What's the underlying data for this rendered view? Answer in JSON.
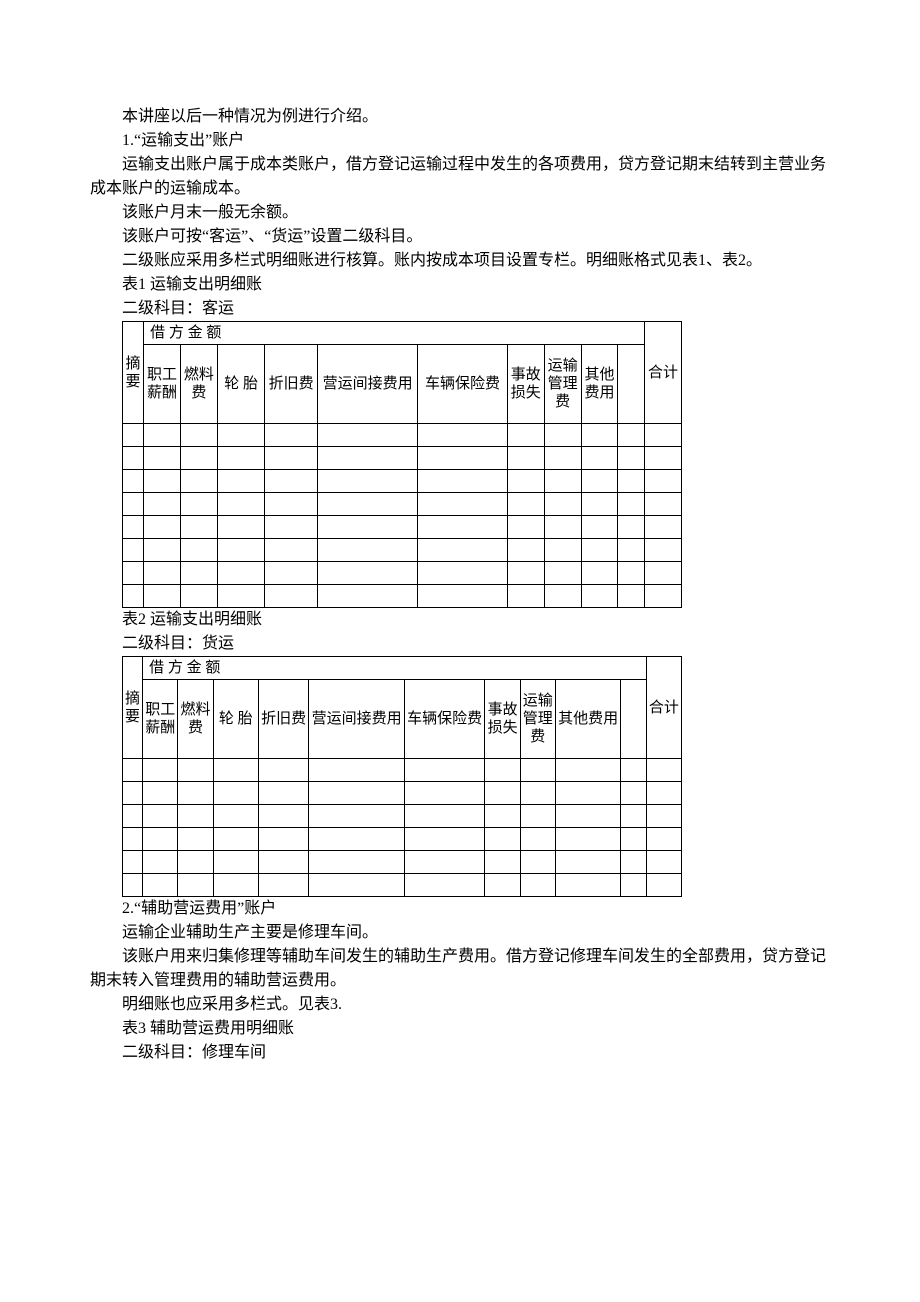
{
  "paragraphs": {
    "p1": "本讲座以后一种情况为例进行介绍。",
    "p2": "1.“运输支出”账户",
    "p3": "运输支出账户属于成本类账户，借方登记运输过程中发生的各项费用，贷方登记期末结转到主营业务成本账户的运输成本。",
    "p4": "该账户月末一般无余额。",
    "p5": "该账户可按“客运”、“货运”设置二级科目。",
    "p6": "二级账应采用多栏式明细账进行核算。账内按成本项目设置专栏。明细账格式见表1、表2。",
    "p7": "表1 运输支出明细账",
    "p8": "二级科目：客运",
    "p9": "表2 运输支出明细账",
    "p10": "二级科目：货运",
    "p11": "2.“辅助营运费用”账户",
    "p12": "运输企业辅助生产主要是修理车间。",
    "p13": "该账户用来归集修理等辅助车间发生的辅助生产费用。借方登记修理车间发生的全部费用，贷方登记期末转入管理费用的辅助营运费用。",
    "p14": "明细账也应采用多栏式。见表3.",
    "p15": "表3 辅助营运费用明细账",
    "p16": "二级科目：修理车间"
  },
  "table1": {
    "header_group": "借 方 金 额",
    "cols": {
      "summary": "摘要",
      "salary": "职工薪酬",
      "fuel": "燃料费",
      "tire": "轮 胎",
      "depreciation": "折旧费",
      "indirect": "营运间接费用",
      "insurance": "车辆保险费",
      "accident": "事故损失",
      "mgmt": "运输管理费",
      "other": "其他费用",
      "blank": "",
      "total": "合计"
    }
  },
  "table2": {
    "header_group": "借 方 金 额",
    "cols": {
      "summary": "摘要",
      "salary": "职工薪酬",
      "fuel": "燃料费",
      "tire": "轮 胎",
      "depreciation": "折旧费",
      "indirect": "营运间接费用",
      "insurance": "车辆保险费",
      "accident": "事故损失",
      "mgmt": "运输管理费",
      "other": "其他费用",
      "blank": "",
      "total": "合计"
    }
  }
}
